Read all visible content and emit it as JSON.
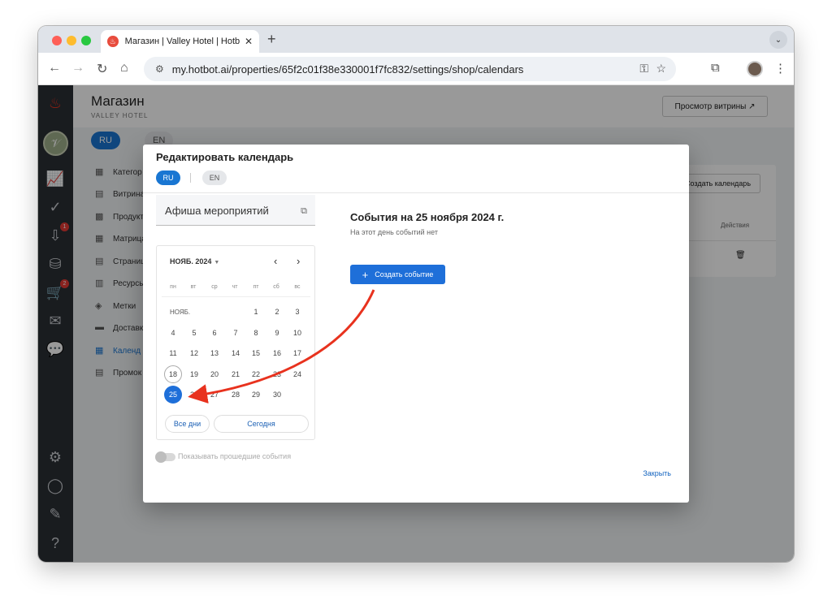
{
  "browser": {
    "tab_title": "Магазин | Valley Hotel | Hotbot",
    "tab_close": "✕",
    "new_tab": "+",
    "url": "my.hotbot.ai/properties/65f2c01f38e330001f7fc832/settings/shop/calendars"
  },
  "sidebar": {
    "badges": {
      "inbox": "1",
      "cart": "2"
    }
  },
  "page": {
    "title": "Магазин",
    "subtitle": "VALLEY HOTEL",
    "storefront_button": "Просмотр витрины ↗",
    "lang_ru": "RU",
    "lang_en": "EN",
    "menu": [
      "Категор",
      "Витрина",
      "Продукт",
      "Матрица",
      "Страниц",
      "Ресурсы",
      "Метки",
      "Доставк",
      "Календ",
      "Промок"
    ],
    "create_calendar": "Создать календарь",
    "actions_header": "Действия"
  },
  "modal": {
    "title": "Редактировать календарь",
    "lang_ru": "RU",
    "lang_en": "EN",
    "calendar_name": "Афиша мероприятий",
    "month": "НОЯБ. 2024",
    "weekdays": [
      "пн",
      "вт",
      "ср",
      "чт",
      "пт",
      "сб",
      "вс"
    ],
    "month_label": "НОЯБ.",
    "all_days": "Все дни",
    "today": "Сегодня",
    "show_past": "Показывать прошедшие события",
    "close": "Закрыть",
    "events_title": "События на 25 ноября 2024 г.",
    "events_empty": "На этот день событий нет",
    "create_event": "Создать событие"
  },
  "colors": {
    "accent": "#1e6fd9",
    "arrow": "#e8321e"
  }
}
